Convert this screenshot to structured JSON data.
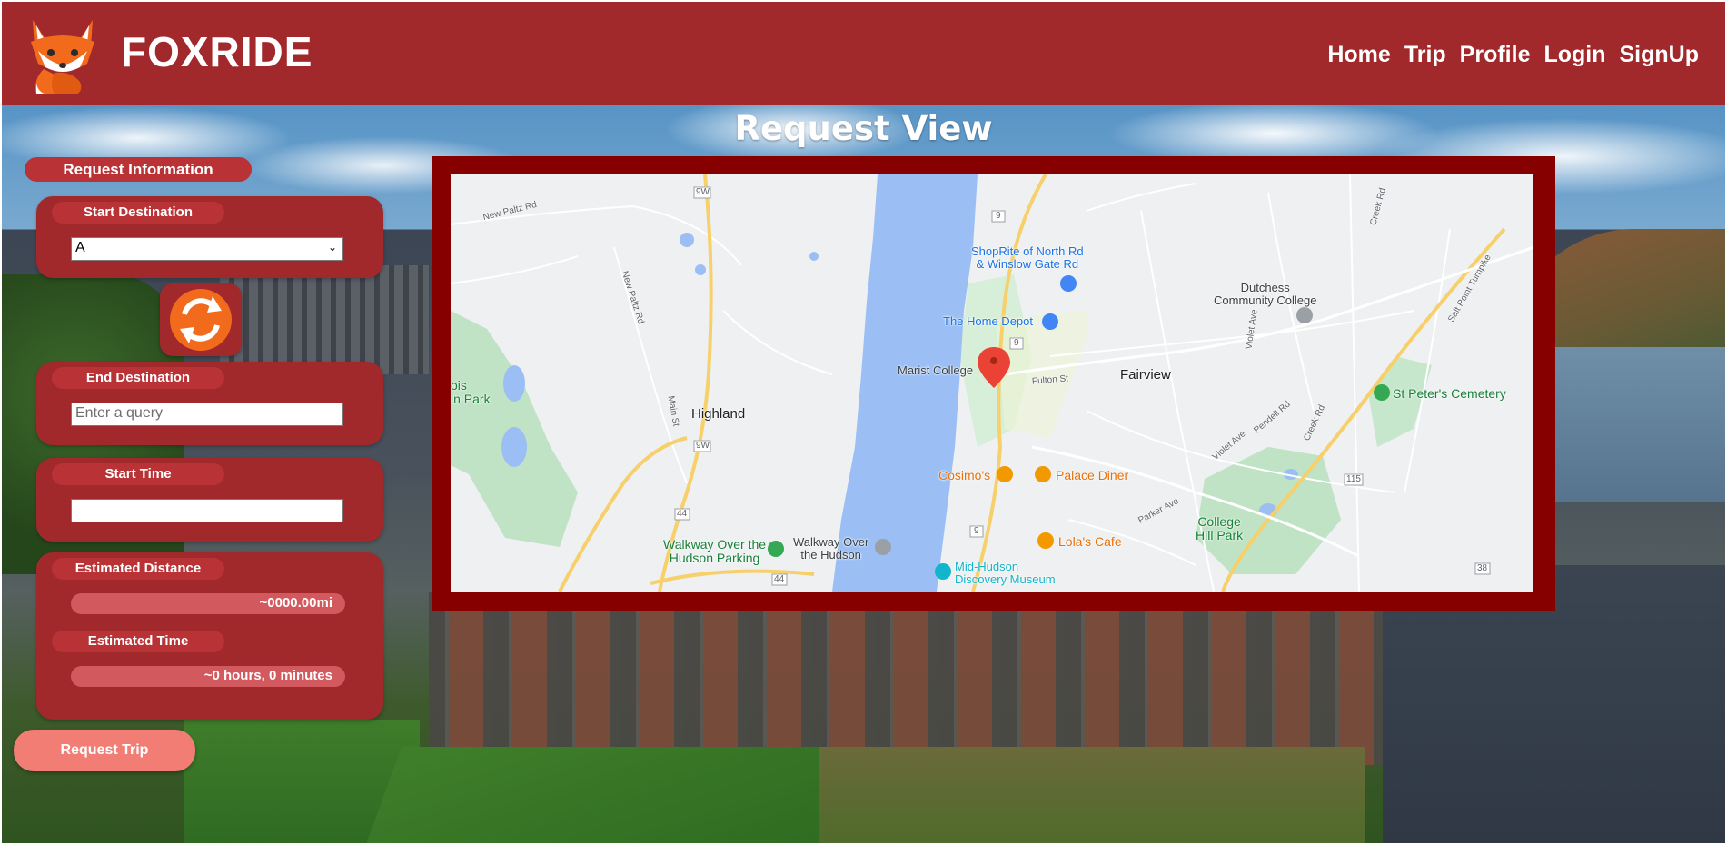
{
  "header": {
    "brand": "FOXRIDE",
    "nav": [
      "Home",
      "Trip",
      "Profile",
      "Login",
      "SignUp"
    ]
  },
  "page_title": "Request View",
  "sidebar": {
    "section_title": "Request Information",
    "start": {
      "label": "Start Destination",
      "selected": "A"
    },
    "end": {
      "label": "End Destination",
      "placeholder": "Enter a query"
    },
    "start_time": {
      "label": "Start Time",
      "value": ""
    },
    "distance": {
      "label": "Estimated Distance",
      "value": "~0000.00mi"
    },
    "time": {
      "label": "Estimated Time",
      "value": "~0 hours, 0 minutes"
    },
    "request_button": "Request Trip"
  },
  "map": {
    "towns": [
      "Highland",
      "Fairview"
    ],
    "places": {
      "marist": "Marist College",
      "shoprite": "ShopRite of North Rd\n& Winslow Gate Rd",
      "homedepot": "The Home Depot",
      "dutchess": "Dutchess\nCommunity College",
      "stpeters": "St Peter's Cemetery",
      "cosimos": "Cosimo's",
      "palace": "Palace Diner",
      "lolas": "Lola's Cafe",
      "walkway_parking": "Walkway Over the\nHudson Parking",
      "walkway": "Walkway Over\nthe Hudson",
      "midhudson": "Mid-Hudson\nDiscovery Museum",
      "college_hill": "College\nHill Park",
      "pois_park": "ois\nin Park"
    },
    "roads": [
      "New Paltz Rd",
      "New Paltz Rd",
      "Main St",
      "Fulton St",
      "Violet Ave",
      "Violet Ave",
      "Pendell Rd",
      "Creek Rd",
      "Creek Rd",
      "Salt Point Turnpike",
      "Parker Ave"
    ],
    "shields": [
      "9W",
      "9W",
      "9",
      "9",
      "9",
      "44",
      "44",
      "115",
      "38"
    ]
  },
  "colors": {
    "header": "#a1282b",
    "panel": "#a1282b",
    "map_frame": "#870000",
    "accent_button": "#f17d74",
    "readout": "#d25a5f"
  }
}
